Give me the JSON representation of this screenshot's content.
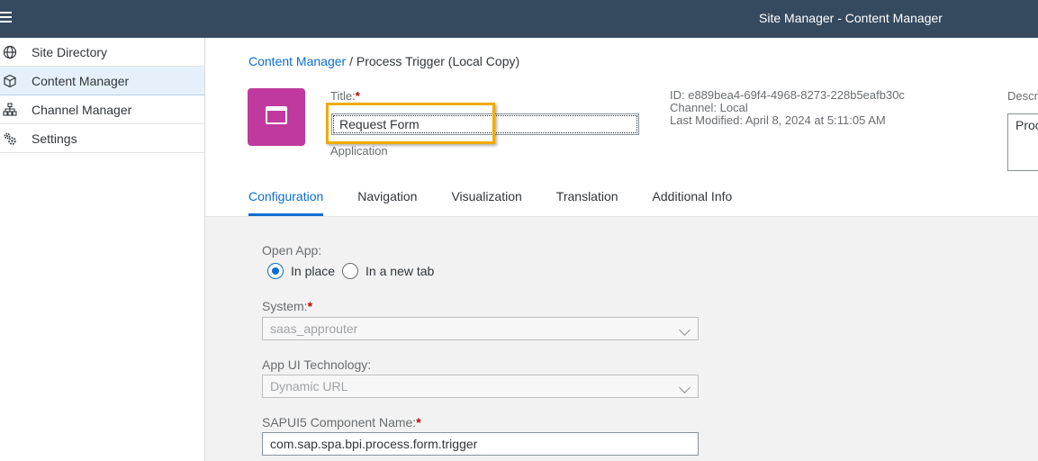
{
  "shell": {
    "title": "Site Manager - Content Manager",
    "menu_icon": "hamburger-icon"
  },
  "sidebar": {
    "items": [
      {
        "label": "Site Directory",
        "icon": "globe-icon"
      },
      {
        "label": "Content Manager",
        "icon": "cube-icon",
        "active": true
      },
      {
        "label": "Channel Manager",
        "icon": "hierarchy-icon"
      },
      {
        "label": "Settings",
        "icon": "gears-icon"
      }
    ]
  },
  "breadcrumb": {
    "link": "Content Manager",
    "separator": " / ",
    "current": "Process Trigger (Local Copy)"
  },
  "header": {
    "title_label": "Title:",
    "required_mark": "*",
    "title_value": "Request Form",
    "type_label": "Application",
    "id_line": "ID:  e889bea4-69f4-4968-8273-228b5eafb30c",
    "channel_line": "Channel:  Local",
    "modified_line": "Last Modified:  April 8, 2024 at 5:11:05 AM",
    "description_label": "Description",
    "description_value": "Process"
  },
  "tabs": [
    "Configuration",
    "Navigation",
    "Visualization",
    "Translation",
    "Additional Info"
  ],
  "form": {
    "open_app_label": "Open App:",
    "open_app_options": [
      "In place",
      "In a new tab"
    ],
    "open_app_selected": "In place",
    "system_label": "System:",
    "system_value": "saas_approuter",
    "technology_label": "App UI Technology:",
    "technology_value": "Dynamic URL",
    "component_label": "SAPUI5 Component Name:",
    "component_value": "com.sap.spa.bpi.process.form.trigger"
  },
  "colors": {
    "shell": "#354a5f",
    "accent": "#0a6ed1",
    "tile": "#c0399f",
    "highlight": "#f0ab00",
    "required": "#bb0000"
  }
}
